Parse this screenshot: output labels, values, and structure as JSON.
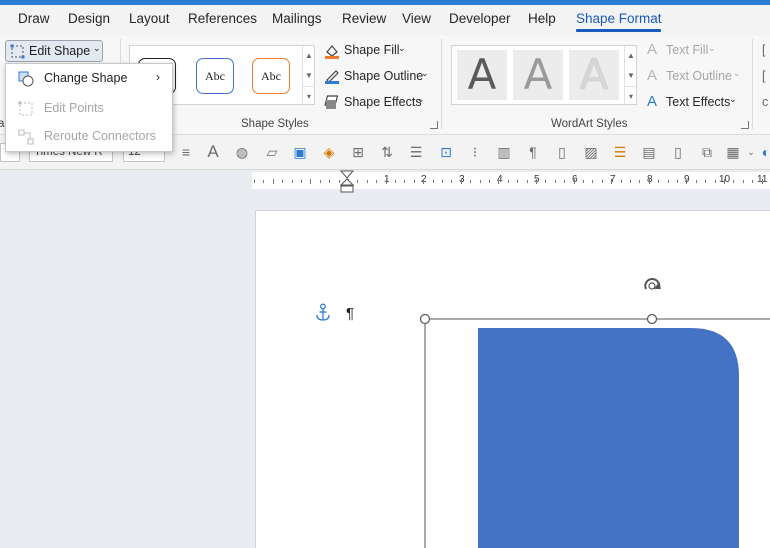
{
  "tabs": [
    "Draw",
    "Design",
    "Layout",
    "References",
    "Mailings",
    "Review",
    "View",
    "Developer",
    "Help",
    "Shape Format"
  ],
  "active_tab": "Shape Format",
  "edit_shape": {
    "label": "Edit Shape",
    "menu": [
      {
        "label": "Change Shape",
        "icon": "change-shape-icon",
        "enabled": true,
        "submenu": true
      },
      {
        "label": "Edit Points",
        "icon": "edit-points-icon",
        "enabled": false
      },
      {
        "label": "Reroute Connectors",
        "icon": "reroute-connectors-icon",
        "enabled": false
      }
    ]
  },
  "shape_styles": {
    "group_label": "Shape Styles",
    "thumb_text": "Abc",
    "shape_fill": "Shape Fill",
    "shape_outline": "Shape Outline",
    "shape_effects": "Shape Effects"
  },
  "wordart_styles": {
    "group_label": "WordArt Styles",
    "letter": "A",
    "text_fill": "Text Fill",
    "text_outline": "Text Outline",
    "text_effects": "Text Effects"
  },
  "font": {
    "name": "Times New R",
    "size": "12"
  },
  "ruler": [
    "1",
    "2",
    "3",
    "4",
    "5",
    "6",
    "7",
    "8",
    "9",
    "10",
    "11"
  ],
  "document": {
    "pilcrow": "¶"
  },
  "colors": {
    "accent": "#185abd",
    "shape_fill": "#4472c4",
    "title_bar": "#2b7cd3"
  }
}
